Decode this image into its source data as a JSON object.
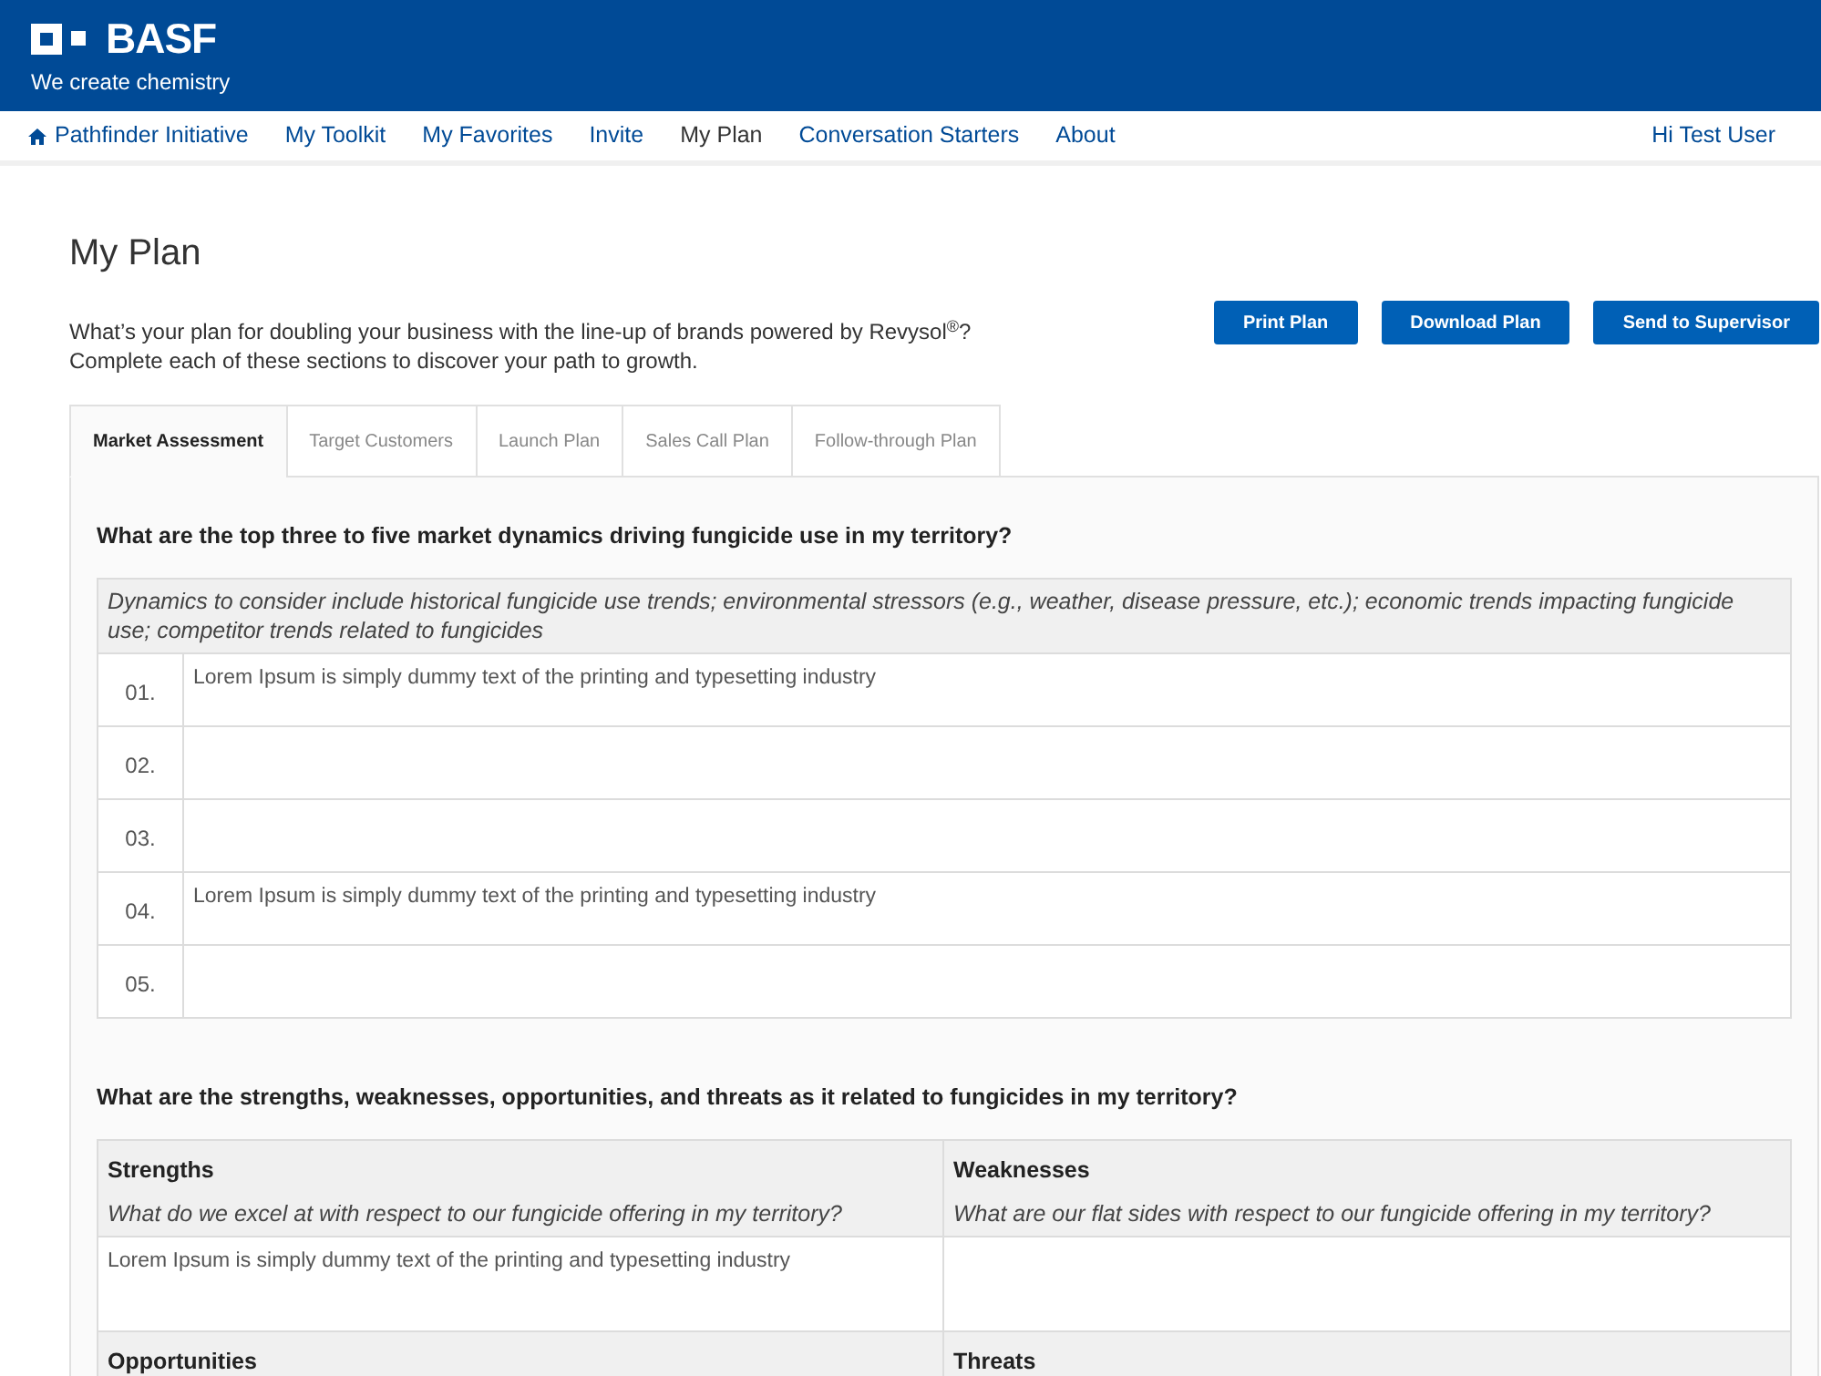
{
  "header": {
    "logo": "BASF",
    "tagline": "We create chemistry"
  },
  "nav": {
    "items": [
      {
        "label": "Pathfinder Initiative",
        "kind": "home",
        "selected": false
      },
      {
        "label": "My Toolkit",
        "kind": "link",
        "selected": false
      },
      {
        "label": "My Favorites",
        "kind": "link",
        "selected": false
      },
      {
        "label": "Invite",
        "kind": "link",
        "selected": false
      },
      {
        "label": "My Plan",
        "kind": "link",
        "selected": true
      },
      {
        "label": "Conversation Starters",
        "kind": "link",
        "selected": false
      },
      {
        "label": "About",
        "kind": "link",
        "selected": false
      }
    ],
    "user": "Hi Test User"
  },
  "page": {
    "title": "My Plan",
    "intro_line_1": "What’s your plan for doubling your business with the line-up of brands powered by Revysol$^{®}$?",
    "intro_line_2": "Complete each of these sections to discover your path to growth.",
    "buttons": [
      "Print Plan",
      "Download Plan",
      "Send to Supervisor"
    ]
  },
  "tabs": [
    {
      "label": "Market Assessment",
      "selected": true
    },
    {
      "label": "Target Customers",
      "selected": false
    },
    {
      "label": "Launch Plan",
      "selected": false
    },
    {
      "label": "Sales Call Plan",
      "selected": false
    },
    {
      "label": "Follow-through Plan",
      "selected": false
    }
  ],
  "dynamics": {
    "question": "What are the top three to five market dynamics driving fungicide use in my territory?",
    "hint": "Dynamics to consider include historical fungicide use trends; environmental stressors (e.g., weather, disease pressure, etc.); economic trends impacting fungicide use; competitor trends related to fungicides",
    "rows": [
      {
        "number": "01.",
        "value": "Lorem Ipsum is simply dummy text of the printing and typesetting industry"
      },
      {
        "number": "02."
      },
      {
        "number": "03."
      },
      {
        "number": "04.",
        "value": "Lorem Ipsum is simply dummy text of the printing and typesetting industry"
      },
      {
        "number": "05."
      }
    ]
  },
  "swot": {
    "question": "What are the strengths, weaknesses, opportunities, and threats as it related to fungicides in my territory?",
    "cells": [
      {
        "title": "Strengths",
        "prompt": "What do we excel at with respect to our fungicide offering in my territory?",
        "value": "Lorem Ipsum is simply dummy text of the printing and typesetting industry"
      },
      {
        "title": "Weaknesses",
        "prompt": "What are our flat sides with respect to our fungicide offering in my territory?"
      },
      {
        "title": "Opportunities"
      },
      {
        "title": "Threats"
      }
    ]
  }
}
